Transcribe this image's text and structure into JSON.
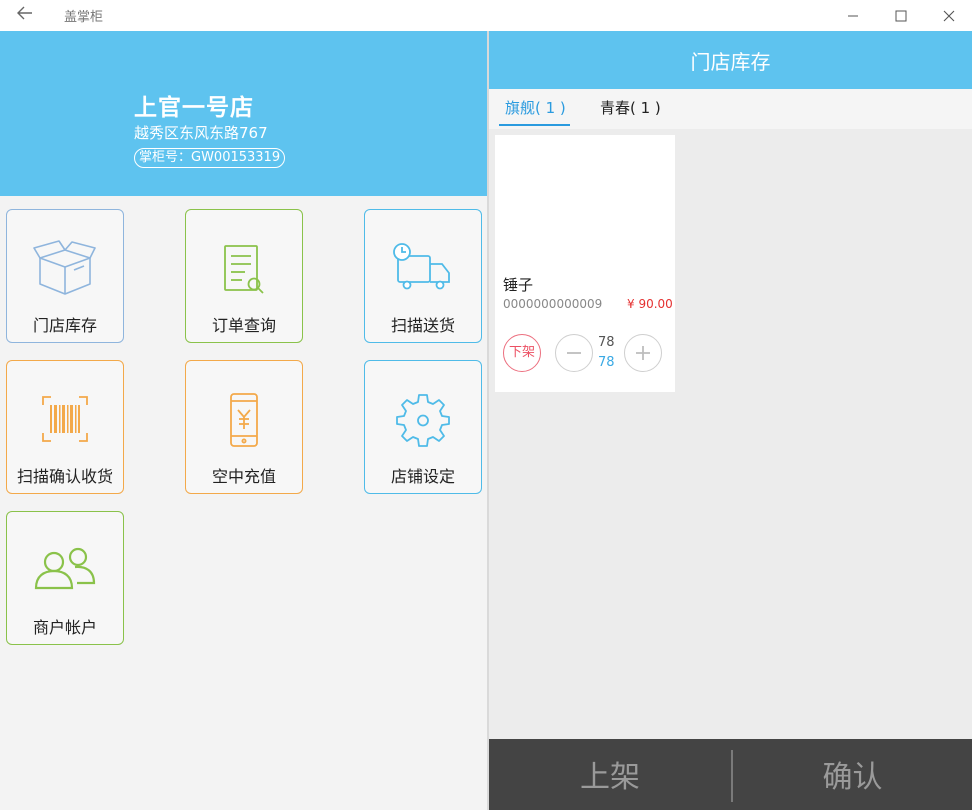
{
  "window": {
    "title": "盖掌柜"
  },
  "store": {
    "name": "上官一号店",
    "address": "越秀区东风东路767",
    "id_label": "掌柜号：GW00153319"
  },
  "menu": [
    {
      "label": "门店库存",
      "icon": "box-icon",
      "color": "#8fb5dd"
    },
    {
      "label": "订单查询",
      "icon": "document-search-icon",
      "color": "#8ac24a"
    },
    {
      "label": "扫描送货",
      "icon": "delivery-truck-icon",
      "color": "#4fbbe8"
    },
    {
      "label": "扫描确认收货",
      "icon": "barcode-scan-icon",
      "color": "#f3a94a"
    },
    {
      "label": "空中充值",
      "icon": "phone-yuan-icon",
      "color": "#f3a94a"
    },
    {
      "label": "店铺设定",
      "icon": "gear-icon",
      "color": "#4fbbe8"
    },
    {
      "label": "商户帐户",
      "icon": "users-icon",
      "color": "#8ac24a"
    }
  ],
  "inventory": {
    "title": "门店库存",
    "tabs": [
      {
        "label": "旗舰( 1 )",
        "active": true
      },
      {
        "label": "青春( 1 )",
        "active": false
      }
    ],
    "products": [
      {
        "name": "锤子",
        "code": "0000000000009",
        "price": "¥ 90.00",
        "off_shelf_label": "下架",
        "stock": "78",
        "count": "78"
      }
    ]
  },
  "actions": {
    "shelf_label": "上架",
    "confirm_label": "确认"
  },
  "colors": {
    "header": "#5ec3ef",
    "accent": "#2b9bdf",
    "price": "#e53131",
    "bottombar": "#444444"
  }
}
